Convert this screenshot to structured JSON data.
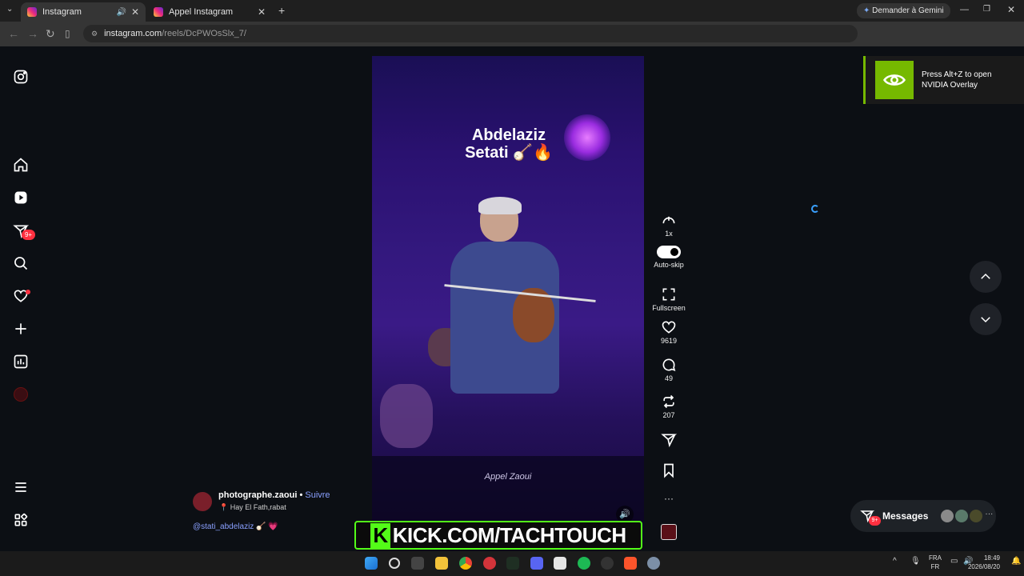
{
  "browser": {
    "tabs": [
      {
        "title": "Instagram",
        "active": true
      },
      {
        "title": "Appel Instagram",
        "active": false
      }
    ],
    "gemini_label": "Demander à Gemini",
    "url_domain": "instagram.com",
    "url_path": "/reels/DcPWOsSlx_7/"
  },
  "sidebar": {
    "messages_badge": "9+"
  },
  "reel": {
    "title_line1": "Abdelaziz",
    "title_line2": "Setati 🪕🔥",
    "signature": "Appel Zaoui"
  },
  "actions": {
    "speed": "1x",
    "autoskip": "Auto-skip",
    "fullscreen": "Fullscreen",
    "likes": "9619",
    "comments": "49",
    "reposts": "207",
    "more": "···"
  },
  "caption": {
    "username": "photographe.zaoui",
    "separator": " • ",
    "follow": "Suivre",
    "location": "Hay El Fath,rabat",
    "text": "@stati_abdelaziz 🪕 💗"
  },
  "overlay": {
    "kick_k": "K",
    "kick_text": "KICK.COM/TACHTOUCH",
    "nvidia_text": "Press Alt+Z to open NVIDIA Overlay"
  },
  "messages": {
    "label": "Messages",
    "badge": "9+"
  },
  "taskbar": {
    "lang1": "FRA",
    "lang2": "FR",
    "time": "18:49",
    "date": "2026/08/20"
  }
}
